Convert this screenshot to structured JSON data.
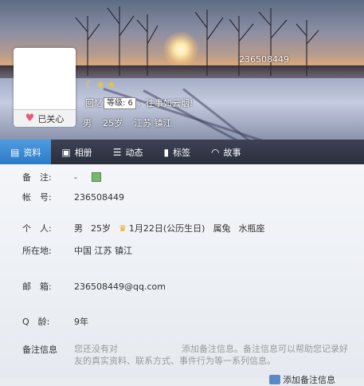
{
  "profile": {
    "qq_number": "236508449",
    "follow_label": "已关心",
    "level_tip": "等级: 6",
    "signature_before": "回忆",
    "signature_after": "，往事如云烟!",
    "gender": "男",
    "age": "25岁",
    "location": "江苏 镇江"
  },
  "tabs": [
    {
      "label": "资料",
      "icon": "profile-card-icon"
    },
    {
      "label": "相册",
      "icon": "photo-album-icon"
    },
    {
      "label": "动态",
      "icon": "feed-list-icon"
    },
    {
      "label": "标签",
      "icon": "bookmark-tag-icon"
    },
    {
      "label": "故事",
      "icon": "rainbow-story-icon"
    }
  ],
  "details": {
    "remark_label": "备　注:",
    "remark_value": "-",
    "account_label": "帐　号:",
    "account_value": "236508449",
    "personal_label": "个　人:",
    "personal_gender": "男",
    "personal_age": "25岁",
    "birthday": "1月22日(公历生日)",
    "zodiac": "属兔",
    "constellation": "水瓶座",
    "location_label": "所在地:",
    "location_value": "中国 江苏 镇江",
    "email_label": "邮　箱:",
    "email_value": "236508449@qq.com",
    "qage_label": "Q　龄:",
    "qage_value": "9年",
    "note_label": "备注信息",
    "note_text_1": "您还没有对",
    "note_text_2": "添加备注信息。备注信息可以帮助您记录好友的真实资料、联系方式、事件行为等一系列信息。",
    "note_link": "添加备注信息"
  }
}
